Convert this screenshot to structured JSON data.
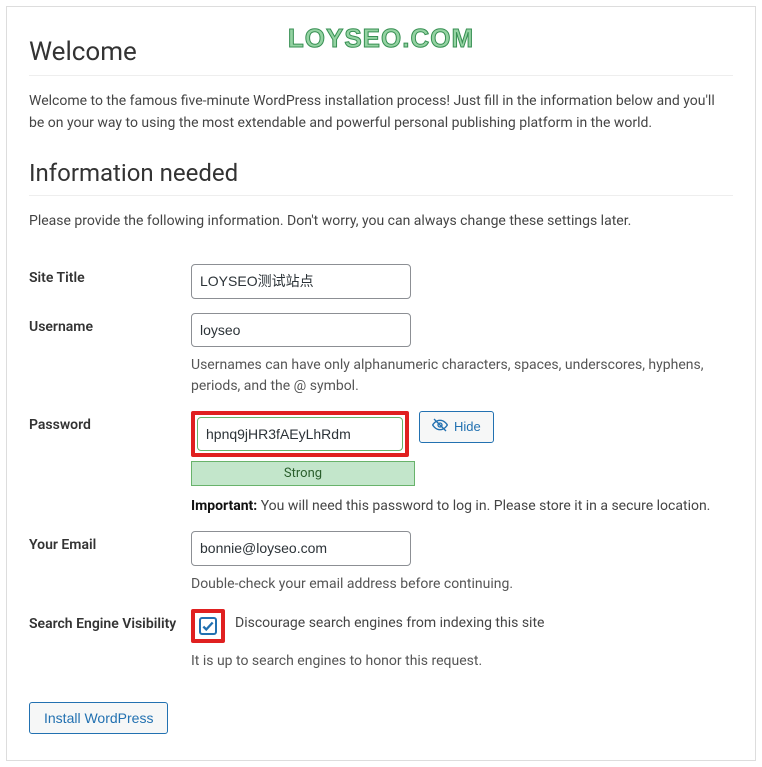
{
  "watermark": "LOYSEO.COM",
  "welcome": {
    "heading": "Welcome",
    "intro": "Welcome to the famous five-minute WordPress installation process! Just fill in the information below and you'll be on your way to using the most extendable and powerful personal publishing platform in the world."
  },
  "info": {
    "heading": "Information needed",
    "intro": "Please provide the following information. Don't worry, you can always change these settings later."
  },
  "fields": {
    "site_title": {
      "label": "Site Title",
      "value": "LOYSEO测试站点"
    },
    "username": {
      "label": "Username",
      "value": "loyseo",
      "hint": "Usernames can have only alphanumeric characters, spaces, underscores, hyphens, periods, and the @ symbol."
    },
    "password": {
      "label": "Password",
      "value": "hpnq9jHR3fAEyLhRdm",
      "hide_label": "Hide",
      "strength": "Strong",
      "note_strong": "Important:",
      "note_rest": " You will need this password to log in. Please store it in a secure location."
    },
    "email": {
      "label": "Your Email",
      "value": "bonnie@loyseo.com",
      "hint": "Double-check your email address before continuing."
    },
    "visibility": {
      "label": "Search Engine Visibility",
      "checkbox_label": "Discourage search engines from indexing this site",
      "checked": true,
      "hint": "It is up to search engines to honor this request."
    }
  },
  "submit": {
    "label": "Install WordPress"
  }
}
